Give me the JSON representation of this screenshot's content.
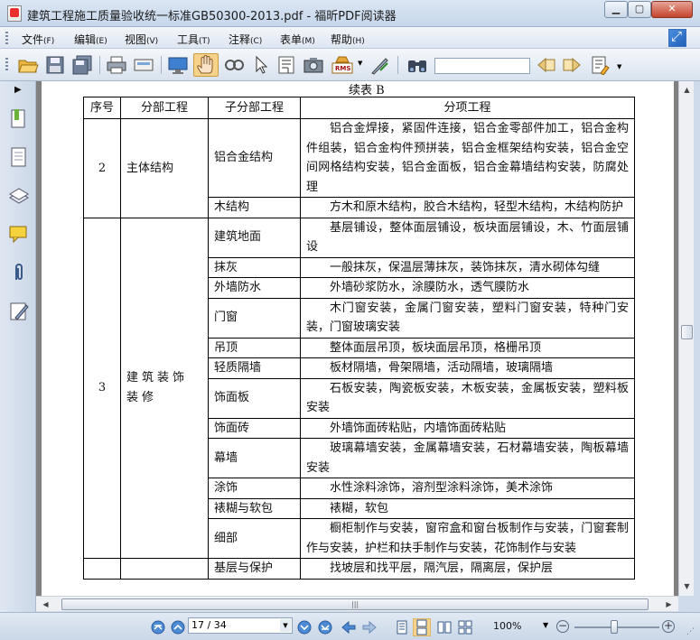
{
  "window": {
    "title": "建筑工程施工质量验收统一标准GB50300-2013.pdf - 福昕PDF阅读器"
  },
  "menu": [
    {
      "label": "文件",
      "key": "(F)"
    },
    {
      "label": "编辑",
      "key": "(E)"
    },
    {
      "label": "视图",
      "key": "(V)"
    },
    {
      "label": "工具",
      "key": "(T)"
    },
    {
      "label": "注释",
      "key": "(C)"
    },
    {
      "label": "表单",
      "key": "(M)"
    },
    {
      "label": "帮助",
      "key": "(H)"
    }
  ],
  "toolbar": {
    "icons": [
      "open-folder-icon",
      "save-icon",
      "save-all-icon",
      "print-icon",
      "scan-icon",
      "fullscreen-icon",
      "hand-tool-icon",
      "snapshot-zoom-icon",
      "select-arrow-icon",
      "text-select-icon",
      "camera-icon",
      "rms-icon",
      "sign-icon",
      "binoculars-icon",
      "find-prev-icon",
      "find-next-icon",
      "highlight-icon"
    ],
    "rms_label": "RMS",
    "search_value": ""
  },
  "document": {
    "caption": "续表 B",
    "headers": [
      "序号",
      "分部工程",
      "子分部工程",
      "分项工程"
    ],
    "group2": {
      "no": "2",
      "division": "主体结构",
      "rows": [
        {
          "sub": "铝合金结构",
          "items": "铝合金焊接，紧固件连接，铝合金零部件加工，铝合金构件组装，铝合金构件预拼装，铝合金框架结构安装，铝合金空间网格结构安装，铝合金面板，铝合金幕墙结构安装，防腐处理"
        },
        {
          "sub": "木结构",
          "items": "方木和原木结构，胶合木结构，轻型木结构，木结构防护"
        }
      ]
    },
    "group3": {
      "no": "3",
      "division": "建筑装饰装修",
      "rows": [
        {
          "sub": "建筑地面",
          "items": "基层铺设，整体面层铺设，板块面层铺设，木、竹面层铺设"
        },
        {
          "sub": "抹灰",
          "items": "一般抹灰，保温层薄抹灰，装饰抹灰，清水砌体勾缝"
        },
        {
          "sub": "外墙防水",
          "items": "外墙砂浆防水，涂膜防水，透气膜防水"
        },
        {
          "sub": "门窗",
          "items": "木门窗安装，金属门窗安装，塑料门窗安装，特种门安装，门窗玻璃安装"
        },
        {
          "sub": "吊顶",
          "items": "整体面层吊顶，板块面层吊顶，格栅吊顶"
        },
        {
          "sub": "轻质隔墙",
          "items": "板材隔墙，骨架隔墙，活动隔墙，玻璃隔墙"
        },
        {
          "sub": "饰面板",
          "items": "石板安装，陶瓷板安装，木板安装，金属板安装，塑料板安装"
        },
        {
          "sub": "饰面砖",
          "items": "外墙饰面砖粘贴，内墙饰面砖粘贴"
        },
        {
          "sub": "幕墙",
          "items": "玻璃幕墙安装，金属幕墙安装，石材幕墙安装，陶板幕墙安装"
        },
        {
          "sub": "涂饰",
          "items": "水性涂料涂饰，溶剂型涂料涂饰，美术涂饰"
        },
        {
          "sub": "裱糊与软包",
          "items": "裱糊，软包"
        },
        {
          "sub": "细部",
          "items": "橱柜制作与安装，窗帘盒和窗台板制作与安装，门窗套制作与安装，护栏和扶手制作与安装，花饰制作与安装"
        }
      ]
    },
    "partial_row": {
      "sub": "基层与保护",
      "items": "找坡层和找平层，隔汽层，隔离层，保护层"
    }
  },
  "statusbar": {
    "page_indicator": "17 / 34",
    "zoom": "100%",
    "zoom_out": "−",
    "zoom_in": "+"
  }
}
